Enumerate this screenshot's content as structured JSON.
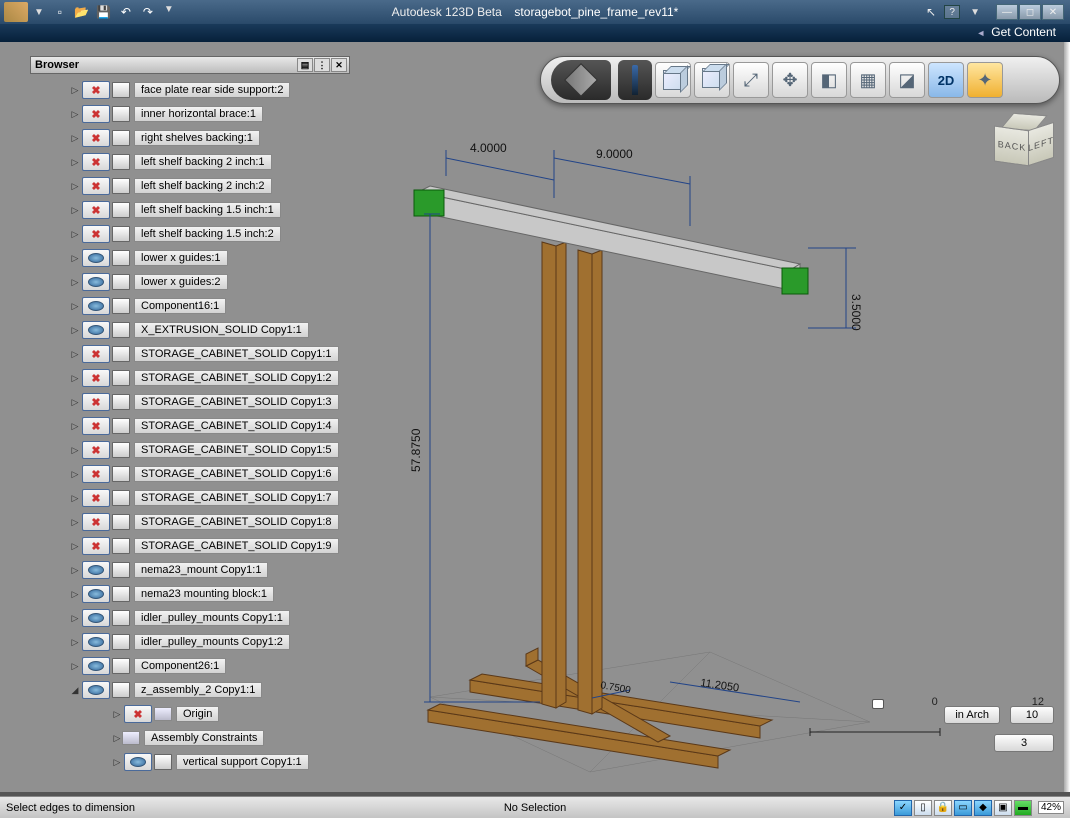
{
  "app": {
    "name": "Autodesk 123D Beta",
    "document": "storagebot_pine_frame_rev11*"
  },
  "header_link": "Get Content",
  "browser": {
    "title": "Browser",
    "items": [
      {
        "vis": "hidden",
        "label": "face plate rear side support:2"
      },
      {
        "vis": "hidden",
        "label": "inner horizontal brace:1"
      },
      {
        "vis": "hidden",
        "label": "right shelves backing:1"
      },
      {
        "vis": "hidden",
        "label": "left shelf backing 2 inch:1"
      },
      {
        "vis": "hidden",
        "label": "left shelf backing 2 inch:2"
      },
      {
        "vis": "hidden",
        "label": "left shelf backing 1.5 inch:1"
      },
      {
        "vis": "hidden",
        "label": "left shelf backing 1.5 inch:2"
      },
      {
        "vis": "visible",
        "label": "lower x guides:1"
      },
      {
        "vis": "visible",
        "label": "lower x guides:2"
      },
      {
        "vis": "visible",
        "label": "Component16:1"
      },
      {
        "vis": "visible",
        "label": "X_EXTRUSION_SOLID Copy1:1"
      },
      {
        "vis": "hidden",
        "label": "STORAGE_CABINET_SOLID Copy1:1"
      },
      {
        "vis": "hidden",
        "label": "STORAGE_CABINET_SOLID Copy1:2"
      },
      {
        "vis": "hidden",
        "label": "STORAGE_CABINET_SOLID Copy1:3"
      },
      {
        "vis": "hidden",
        "label": "STORAGE_CABINET_SOLID Copy1:4"
      },
      {
        "vis": "hidden",
        "label": "STORAGE_CABINET_SOLID Copy1:5"
      },
      {
        "vis": "hidden",
        "label": "STORAGE_CABINET_SOLID Copy1:6"
      },
      {
        "vis": "hidden",
        "label": "STORAGE_CABINET_SOLID Copy1:7"
      },
      {
        "vis": "hidden",
        "label": "STORAGE_CABINET_SOLID Copy1:8"
      },
      {
        "vis": "hidden",
        "label": "STORAGE_CABINET_SOLID Copy1:9"
      },
      {
        "vis": "visible",
        "label": "nema23_mount Copy1:1"
      },
      {
        "vis": "visible",
        "label": "nema23 mounting block:1"
      },
      {
        "vis": "visible",
        "label": "idler_pulley_mounts Copy1:1"
      },
      {
        "vis": "visible",
        "label": "idler_pulley_mounts Copy1:2"
      },
      {
        "vis": "visible",
        "label": "Component26:1"
      },
      {
        "vis": "visible",
        "label": "z_assembly_2 Copy1:1",
        "expanded": true
      }
    ],
    "subitems": [
      {
        "type": "origin",
        "vis": "hidden",
        "label": "Origin"
      },
      {
        "type": "folder",
        "label": "Assembly Constraints"
      },
      {
        "type": "comp",
        "vis": "visible",
        "label": "vertical support Copy1:1"
      }
    ]
  },
  "dimensions": {
    "d1": "4.0000",
    "d2": "9.0000",
    "d3": "3.5000",
    "d4": "57.8750",
    "d5": "0.7500",
    "d6": "11.2050"
  },
  "ruler": {
    "a": "0",
    "b": "12",
    "val": "3"
  },
  "units_box": "in Arch",
  "num_box": "10",
  "viewcube": {
    "back": "BACK",
    "left": "LEFT"
  },
  "toolbar": {
    "td": "2D"
  },
  "status": {
    "left": "Select edges to dimension",
    "mid": "No Selection",
    "zoom": "42%"
  }
}
